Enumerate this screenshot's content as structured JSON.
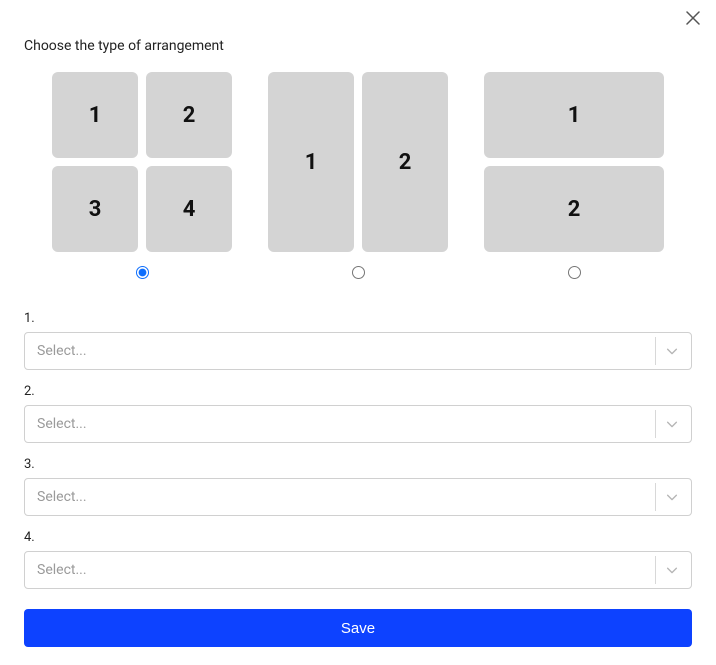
{
  "title": "Choose the type of arrangement",
  "arrangements": {
    "grid": {
      "cells": [
        "1",
        "2",
        "3",
        "4"
      ],
      "selected": true
    },
    "columns": {
      "cells": [
        "1",
        "2"
      ],
      "selected": false
    },
    "rows": {
      "cells": [
        "1",
        "2"
      ],
      "selected": false
    }
  },
  "fields": [
    {
      "label": "1.",
      "placeholder": "Select..."
    },
    {
      "label": "2.",
      "placeholder": "Select..."
    },
    {
      "label": "3.",
      "placeholder": "Select..."
    },
    {
      "label": "4.",
      "placeholder": "Select..."
    }
  ],
  "buttons": {
    "save": "Save"
  }
}
